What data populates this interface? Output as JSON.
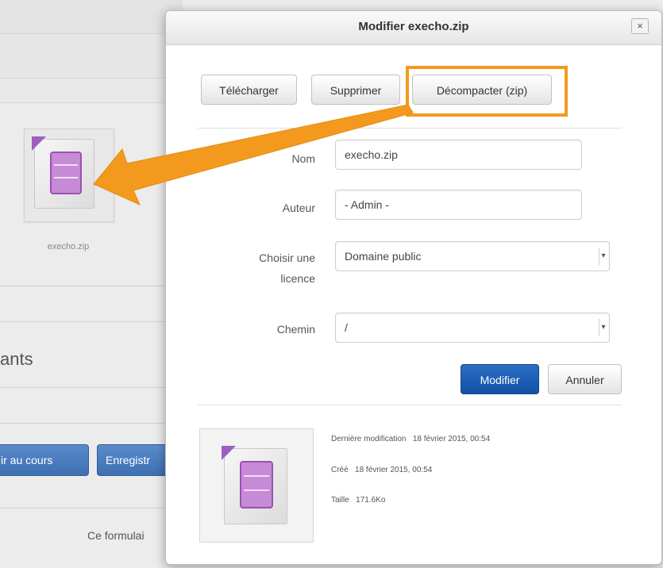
{
  "background": {
    "file_caption": "execho.zip",
    "section_heading_partial": "ants",
    "button_1_partial": "ir au cours",
    "button_2_partial": "Enregistr",
    "footer_partial": "Ce formulai"
  },
  "dialog": {
    "title": "Modifier execho.zip",
    "close_glyph": "×",
    "actions": {
      "download": "Télécharger",
      "delete": "Supprimer",
      "unzip": "Décompacter (zip)"
    },
    "form": {
      "name_label": "Nom",
      "name_value": "execho.zip",
      "author_label": "Auteur",
      "author_value": "- Admin -",
      "license_label_line1": "Choisir une",
      "license_label_line2": "licence",
      "license_value": "Domaine public",
      "path_label": "Chemin",
      "path_value": "/"
    },
    "buttons": {
      "update": "Modifier",
      "cancel": "Annuler"
    },
    "meta": {
      "modified_label": "Dernière modification",
      "modified_value": "18 février 2015, 00:54",
      "created_label": "Créé",
      "created_value": "18 février 2015, 00:54",
      "size_label": "Taille",
      "size_value": "171.6Ko"
    }
  },
  "colors": {
    "highlight": "#f39a1e",
    "primary_button": "#1251a6",
    "zip_icon_purple": "#c78ad6"
  },
  "icons": [
    "zip-file-icon",
    "close-icon",
    "select-arrow-icon",
    "callout-arrow"
  ]
}
